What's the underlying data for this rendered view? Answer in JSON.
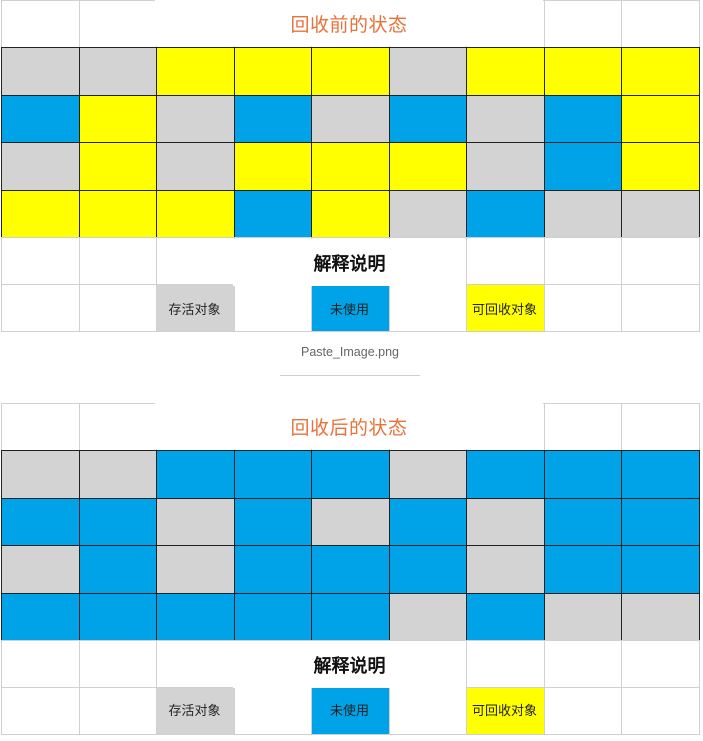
{
  "colors": {
    "live": "#d3d3d3",
    "free": "#00a2e8",
    "garbage": "#ffff00",
    "title": "#e8733a"
  },
  "before": {
    "title": "回收前的状态",
    "rows": [
      [
        "live",
        "live",
        "garbage",
        "garbage",
        "garbage",
        "live",
        "garbage",
        "garbage",
        "garbage"
      ],
      [
        "free",
        "garbage",
        "live",
        "free",
        "live",
        "free",
        "live",
        "free",
        "garbage"
      ],
      [
        "live",
        "garbage",
        "live",
        "garbage",
        "garbage",
        "garbage",
        "live",
        "free",
        "garbage"
      ],
      [
        "garbage",
        "garbage",
        "garbage",
        "free",
        "garbage",
        "live",
        "free",
        "live",
        "live"
      ]
    ],
    "explanation": "解释说明",
    "legend": {
      "live": "存活对象",
      "free": "未使用",
      "garbage": "可回收对象"
    }
  },
  "caption": "Paste_Image.png",
  "after": {
    "title": "回收后的状态",
    "rows": [
      [
        "live",
        "live",
        "free",
        "free",
        "free",
        "live",
        "free",
        "free",
        "free"
      ],
      [
        "free",
        "free",
        "live",
        "free",
        "live",
        "free",
        "live",
        "free",
        "free"
      ],
      [
        "live",
        "free",
        "live",
        "free",
        "free",
        "free",
        "live",
        "free",
        "free"
      ],
      [
        "free",
        "free",
        "free",
        "free",
        "free",
        "live",
        "free",
        "live",
        "live"
      ]
    ],
    "explanation": "解释说明",
    "legend": {
      "live": "存活对象",
      "free": "未使用",
      "garbage": "可回收对象"
    }
  }
}
